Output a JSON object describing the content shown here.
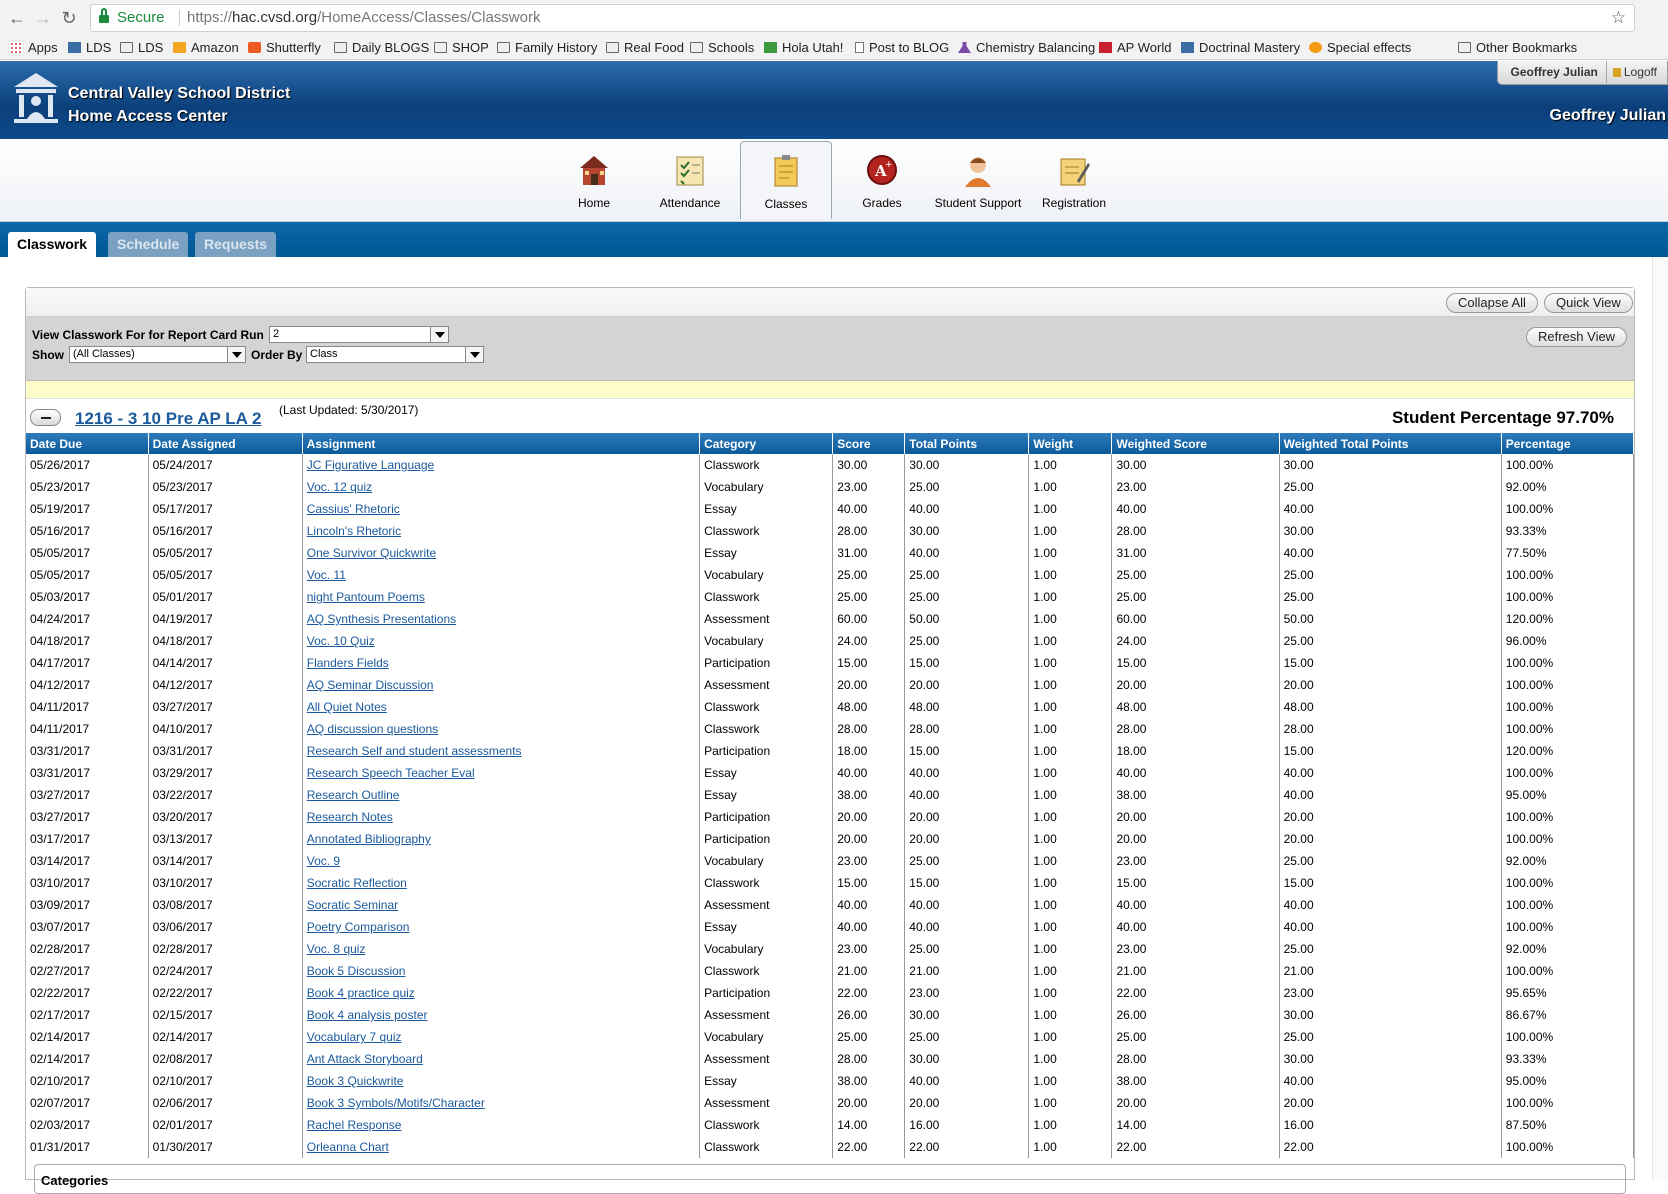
{
  "browser": {
    "secure_label": "Secure",
    "url_prefix": "https://",
    "url_host": "hac.cvsd.org",
    "url_path": "/HomeAccess/Classes/Classwork"
  },
  "bookmarks": [
    {
      "label": "Apps",
      "icon": "grid"
    },
    {
      "label": "LDS",
      "icon": "img"
    },
    {
      "label": "LDS",
      "icon": "folder"
    },
    {
      "label": "Amazon",
      "icon": "amazon"
    },
    {
      "label": "Shutterfly",
      "icon": "shutter"
    },
    {
      "label": "Daily BLOGS",
      "icon": "folder"
    },
    {
      "label": "SHOP",
      "icon": "folder"
    },
    {
      "label": "Family History",
      "icon": "folder"
    },
    {
      "label": "Real Food",
      "icon": "folder"
    },
    {
      "label": "Schools",
      "icon": "folder"
    },
    {
      "label": "Hola Utah!",
      "icon": "hola"
    },
    {
      "label": "Post to BLOG",
      "icon": "page"
    },
    {
      "label": "Chemistry Balancing",
      "icon": "flask"
    },
    {
      "label": "AP World",
      "icon": "red"
    },
    {
      "label": "Doctrinal Mastery",
      "icon": "img"
    },
    {
      "label": "Special effects",
      "icon": "sun"
    },
    {
      "label": "Other Bookmarks",
      "icon": "folder"
    }
  ],
  "header": {
    "district": "Central Valley School District",
    "center": "Home Access Center",
    "user_box_name": "Geoffrey Julian",
    "logoff": "Logoff",
    "user_name": "Geoffrey Julian"
  },
  "nav": [
    {
      "label": "Home",
      "icon": "home-icon"
    },
    {
      "label": "Attendance",
      "icon": "attendance-icon"
    },
    {
      "label": "Classes",
      "icon": "classes-icon",
      "active": true
    },
    {
      "label": "Grades",
      "icon": "grades-icon"
    },
    {
      "label": "Student Support",
      "icon": "student-support-icon"
    },
    {
      "label": "Registration",
      "icon": "registration-icon"
    }
  ],
  "subtabs": [
    "Classwork",
    "Schedule",
    "Requests"
  ],
  "toolbar": {
    "collapse_all": "Collapse All",
    "quick_view": "Quick View",
    "refresh_view": "Refresh View"
  },
  "filters": {
    "report_run_label": "View Classwork For for Report Card Run",
    "report_run_value": "2",
    "show_label": "Show",
    "show_value": "(All Classes)",
    "order_label": "Order By",
    "order_value": "Class"
  },
  "class": {
    "title": "1216 - 3 10 Pre AP LA 2",
    "last_updated": "(Last Updated: 5/30/2017)",
    "student_percentage": "Student Percentage 97.70%"
  },
  "columns": [
    "Date Due",
    "Date Assigned",
    "Assignment",
    "Category",
    "Score",
    "Total Points",
    "Weight",
    "Weighted Score",
    "Weighted Total Points",
    "Percentage"
  ],
  "rows": [
    [
      "05/26/2017",
      "05/24/2017",
      "JC Figurative Language",
      "Classwork",
      "30.00",
      "30.00",
      "1.00",
      "30.00",
      "30.00",
      "100.00%"
    ],
    [
      "05/23/2017",
      "05/23/2017",
      "Voc. 12 quiz",
      "Vocabulary",
      "23.00",
      "25.00",
      "1.00",
      "23.00",
      "25.00",
      "92.00%"
    ],
    [
      "05/19/2017",
      "05/17/2017",
      "Cassius' Rhetoric",
      "Essay",
      "40.00",
      "40.00",
      "1.00",
      "40.00",
      "40.00",
      "100.00%"
    ],
    [
      "05/16/2017",
      "05/16/2017",
      "Lincoln's Rhetoric",
      "Classwork",
      "28.00",
      "30.00",
      "1.00",
      "28.00",
      "30.00",
      "93.33%"
    ],
    [
      "05/05/2017",
      "05/05/2017",
      "One Survivor Quickwrite",
      "Essay",
      "31.00",
      "40.00",
      "1.00",
      "31.00",
      "40.00",
      "77.50%"
    ],
    [
      "05/05/2017",
      "05/05/2017",
      "Voc. 11",
      "Vocabulary",
      "25.00",
      "25.00",
      "1.00",
      "25.00",
      "25.00",
      "100.00%"
    ],
    [
      "05/03/2017",
      "05/01/2017",
      "night Pantoum Poems",
      "Classwork",
      "25.00",
      "25.00",
      "1.00",
      "25.00",
      "25.00",
      "100.00%"
    ],
    [
      "04/24/2017",
      "04/19/2017",
      "AQ Synthesis Presentations",
      "Assessment",
      "60.00",
      "50.00",
      "1.00",
      "60.00",
      "50.00",
      "120.00%"
    ],
    [
      "04/18/2017",
      "04/18/2017",
      "Voc. 10 Quiz",
      "Vocabulary",
      "24.00",
      "25.00",
      "1.00",
      "24.00",
      "25.00",
      "96.00%"
    ],
    [
      "04/17/2017",
      "04/14/2017",
      "Flanders Fields",
      "Participation",
      "15.00",
      "15.00",
      "1.00",
      "15.00",
      "15.00",
      "100.00%"
    ],
    [
      "04/12/2017",
      "04/12/2017",
      "AQ Seminar Discussion",
      "Assessment",
      "20.00",
      "20.00",
      "1.00",
      "20.00",
      "20.00",
      "100.00%"
    ],
    [
      "04/11/2017",
      "03/27/2017",
      "All Quiet Notes",
      "Classwork",
      "48.00",
      "48.00",
      "1.00",
      "48.00",
      "48.00",
      "100.00%"
    ],
    [
      "04/11/2017",
      "04/10/2017",
      "AQ discussion questions",
      "Classwork",
      "28.00",
      "28.00",
      "1.00",
      "28.00",
      "28.00",
      "100.00%"
    ],
    [
      "03/31/2017",
      "03/31/2017",
      "Research Self and student assessments",
      "Participation",
      "18.00",
      "15.00",
      "1.00",
      "18.00",
      "15.00",
      "120.00%"
    ],
    [
      "03/31/2017",
      "03/29/2017",
      "Research Speech Teacher Eval",
      "Essay",
      "40.00",
      "40.00",
      "1.00",
      "40.00",
      "40.00",
      "100.00%"
    ],
    [
      "03/27/2017",
      "03/22/2017",
      "Research Outline",
      "Essay",
      "38.00",
      "40.00",
      "1.00",
      "38.00",
      "40.00",
      "95.00%"
    ],
    [
      "03/27/2017",
      "03/20/2017",
      "Research Notes",
      "Participation",
      "20.00",
      "20.00",
      "1.00",
      "20.00",
      "20.00",
      "100.00%"
    ],
    [
      "03/17/2017",
      "03/13/2017",
      "Annotated Bibliography",
      "Participation",
      "20.00",
      "20.00",
      "1.00",
      "20.00",
      "20.00",
      "100.00%"
    ],
    [
      "03/14/2017",
      "03/14/2017",
      "Voc. 9",
      "Vocabulary",
      "23.00",
      "25.00",
      "1.00",
      "23.00",
      "25.00",
      "92.00%"
    ],
    [
      "03/10/2017",
      "03/10/2017",
      "Socratic Reflection",
      "Classwork",
      "15.00",
      "15.00",
      "1.00",
      "15.00",
      "15.00",
      "100.00%"
    ],
    [
      "03/09/2017",
      "03/08/2017",
      "Socratic Seminar",
      "Assessment",
      "40.00",
      "40.00",
      "1.00",
      "40.00",
      "40.00",
      "100.00%"
    ],
    [
      "03/07/2017",
      "03/06/2017",
      "Poetry Comparison",
      "Essay",
      "40.00",
      "40.00",
      "1.00",
      "40.00",
      "40.00",
      "100.00%"
    ],
    [
      "02/28/2017",
      "02/28/2017",
      "Voc. 8 quiz",
      "Vocabulary",
      "23.00",
      "25.00",
      "1.00",
      "23.00",
      "25.00",
      "92.00%"
    ],
    [
      "02/27/2017",
      "02/24/2017",
      "Book 5 Discussion",
      "Classwork",
      "21.00",
      "21.00",
      "1.00",
      "21.00",
      "21.00",
      "100.00%"
    ],
    [
      "02/22/2017",
      "02/22/2017",
      "Book 4 practice quiz",
      "Participation",
      "22.00",
      "23.00",
      "1.00",
      "22.00",
      "23.00",
      "95.65%"
    ],
    [
      "02/17/2017",
      "02/15/2017",
      "Book 4 analysis poster",
      "Assessment",
      "26.00",
      "30.00",
      "1.00",
      "26.00",
      "30.00",
      "86.67%"
    ],
    [
      "02/14/2017",
      "02/14/2017",
      "Vocabulary 7 quiz",
      "Vocabulary",
      "25.00",
      "25.00",
      "1.00",
      "25.00",
      "25.00",
      "100.00%"
    ],
    [
      "02/14/2017",
      "02/08/2017",
      "Ant Attack Storyboard",
      "Assessment",
      "28.00",
      "30.00",
      "1.00",
      "28.00",
      "30.00",
      "93.33%"
    ],
    [
      "02/10/2017",
      "02/10/2017",
      "Book 3 Quickwrite",
      "Essay",
      "38.00",
      "40.00",
      "1.00",
      "38.00",
      "40.00",
      "95.00%"
    ],
    [
      "02/07/2017",
      "02/06/2017",
      "Book 3 Symbols/Motifs/Character",
      "Assessment",
      "20.00",
      "20.00",
      "1.00",
      "20.00",
      "20.00",
      "100.00%"
    ],
    [
      "02/03/2017",
      "02/01/2017",
      "Rachel Response",
      "Classwork",
      "14.00",
      "16.00",
      "1.00",
      "14.00",
      "16.00",
      "87.50%"
    ],
    [
      "01/31/2017",
      "01/30/2017",
      "Orleanna Chart",
      "Classwork",
      "22.00",
      "22.00",
      "1.00",
      "22.00",
      "22.00",
      "100.00%"
    ]
  ],
  "categories_label": "Categories"
}
